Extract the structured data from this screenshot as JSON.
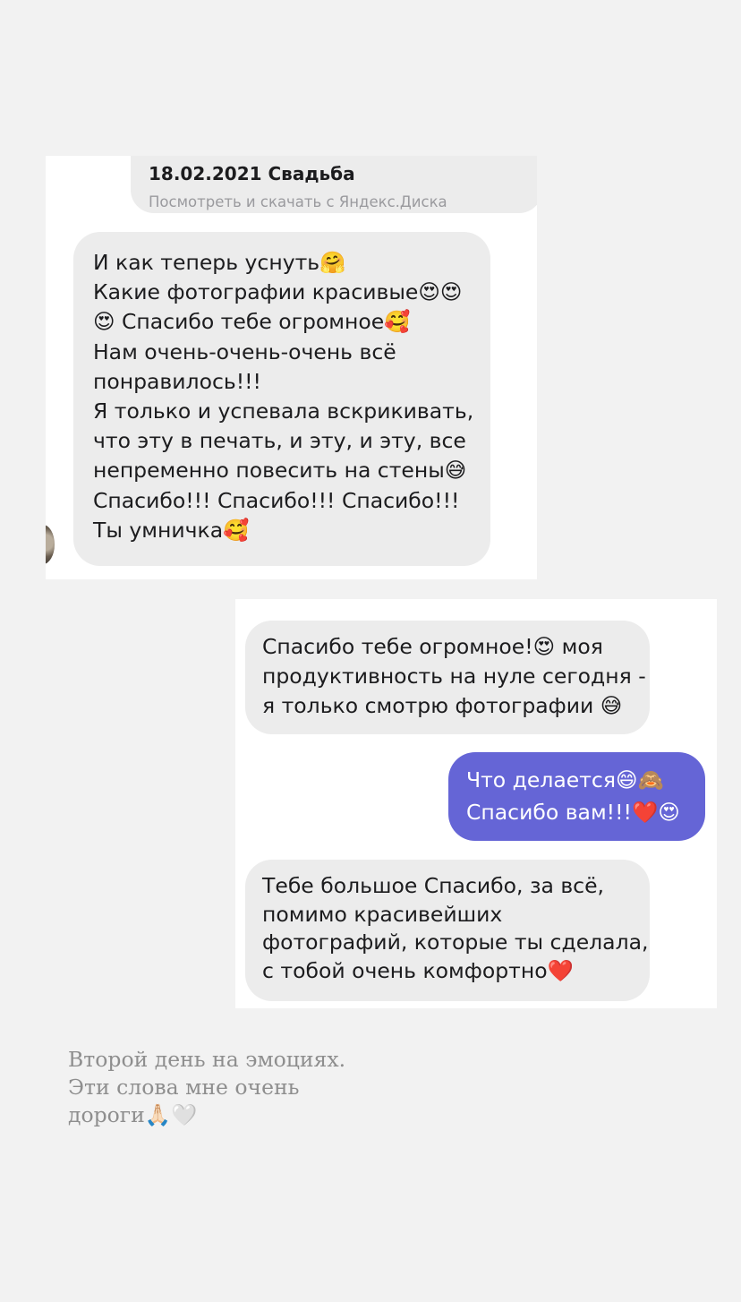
{
  "chat": {
    "link_preview": {
      "title": "18.02.2021 Свадьба",
      "subtitle": "Посмотреть и скачать с Яндекс.Диска"
    },
    "incoming_message_1": {
      "lines": [
        "И как теперь уснуть🤗",
        "Какие фотографии красивые😍😍",
        "😍 Спасибо тебе огромное🥰",
        "Нам очень-очень-очень всё",
        "понравилось!!!",
        "Я только и успевала вскрикивать,",
        "что эту в печать, и эту, и эту, все",
        "непременно повесить на стены😅",
        "Спасибо!!! Спасибо!!! Спасибо!!!",
        "Ты умничка🥰"
      ]
    },
    "incoming_message_2": {
      "lines": [
        "Спасибо тебе огромное!😍 моя",
        "продуктивность на нуле сегодня -",
        "я только смотрю фотографии 😅"
      ]
    },
    "outgoing_message": {
      "lines": [
        "Что делается😄🙈",
        "Спасибо вам!!!❤️😍"
      ]
    },
    "incoming_message_3": {
      "lines": [
        "Тебе большое Спасибо, за всё,",
        "помимо красивейших",
        "фотографий, которые ты сделала,",
        "с тобой очень комфортно❤️"
      ]
    }
  },
  "caption": {
    "lines": [
      "Второй день на эмоциях.",
      "Эти слова мне очень",
      "дороги🙏🏻🤍"
    ]
  },
  "colors": {
    "background": "#f2f2f2",
    "incoming_bubble": "#ececec",
    "outgoing_bubble": "#6565d6",
    "caption_text": "#8e8e8e"
  }
}
